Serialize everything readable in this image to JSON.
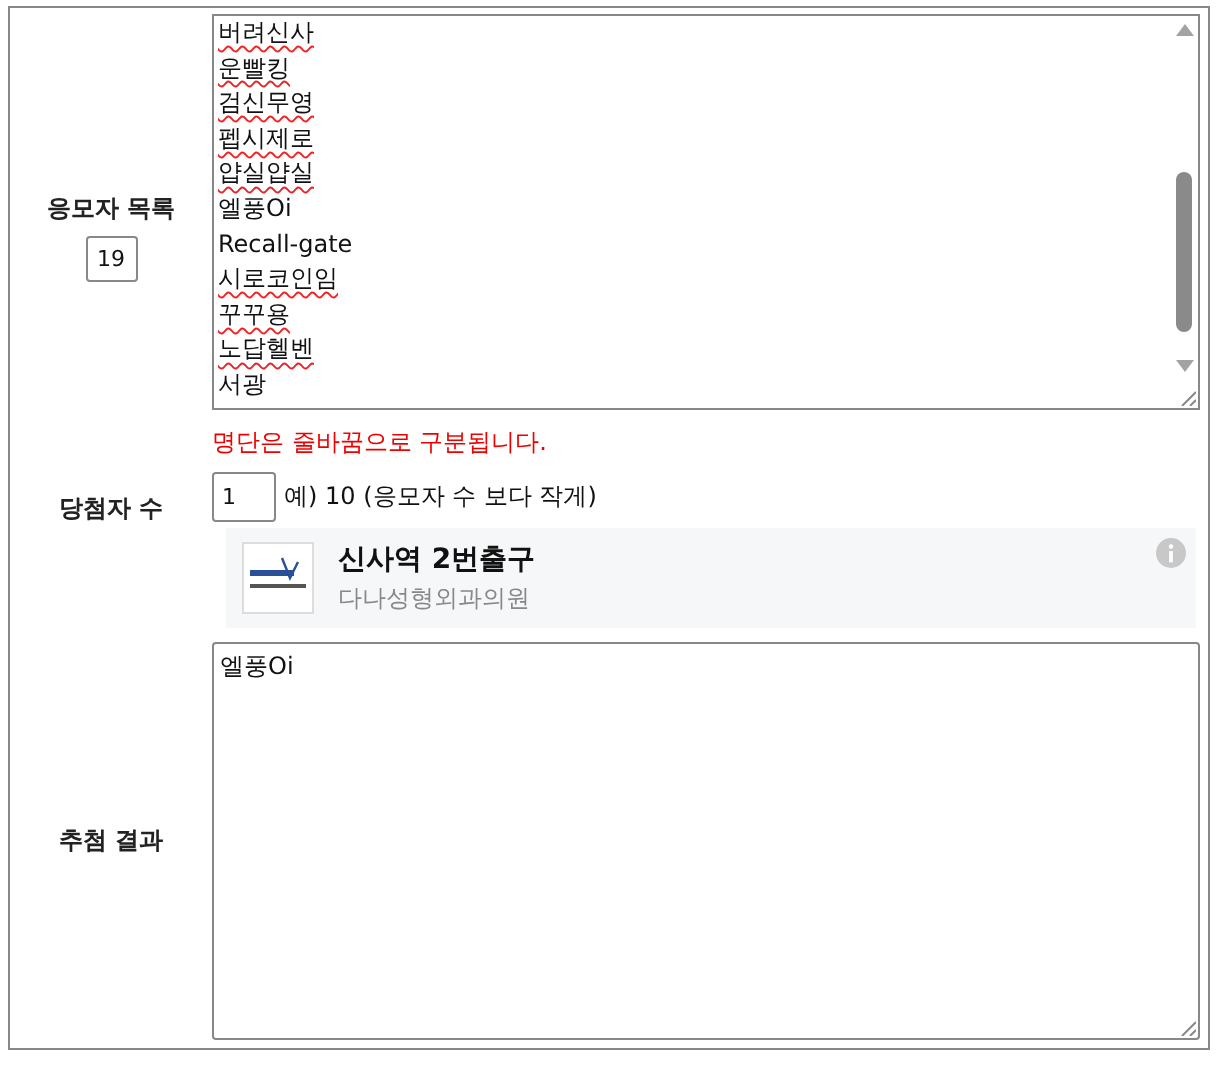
{
  "applicants": {
    "label": "응모자 목록",
    "count": "19",
    "names": [
      {
        "text": "버려신사",
        "misspelled": true
      },
      {
        "text": "운빨킹",
        "misspelled": true
      },
      {
        "text": "검신무영",
        "misspelled": true
      },
      {
        "text": "펩시제로",
        "misspelled": true
      },
      {
        "text": "얍실얍실",
        "misspelled": true
      },
      {
        "text": "엘풍Oi",
        "misspelled": false
      },
      {
        "text": "Recall-gate",
        "misspelled": false
      },
      {
        "text": "시로코인임",
        "misspelled": true
      },
      {
        "text": "꾸꾸용",
        "misspelled": true
      },
      {
        "text": "노답헬벤",
        "misspelled": true
      },
      {
        "text": "서광",
        "misspelled": false
      }
    ],
    "note": "명단은 줄바꿈으로 구분됩니다."
  },
  "winners": {
    "label": "당첨자 수",
    "value": "1",
    "hint": "예) 10 (응모자 수 보다 작게)"
  },
  "ad": {
    "title": "신사역 2번출구",
    "subtitle": "다나성형외과의원"
  },
  "result": {
    "label": "추첨 결과",
    "value": "엘풍Oi"
  }
}
